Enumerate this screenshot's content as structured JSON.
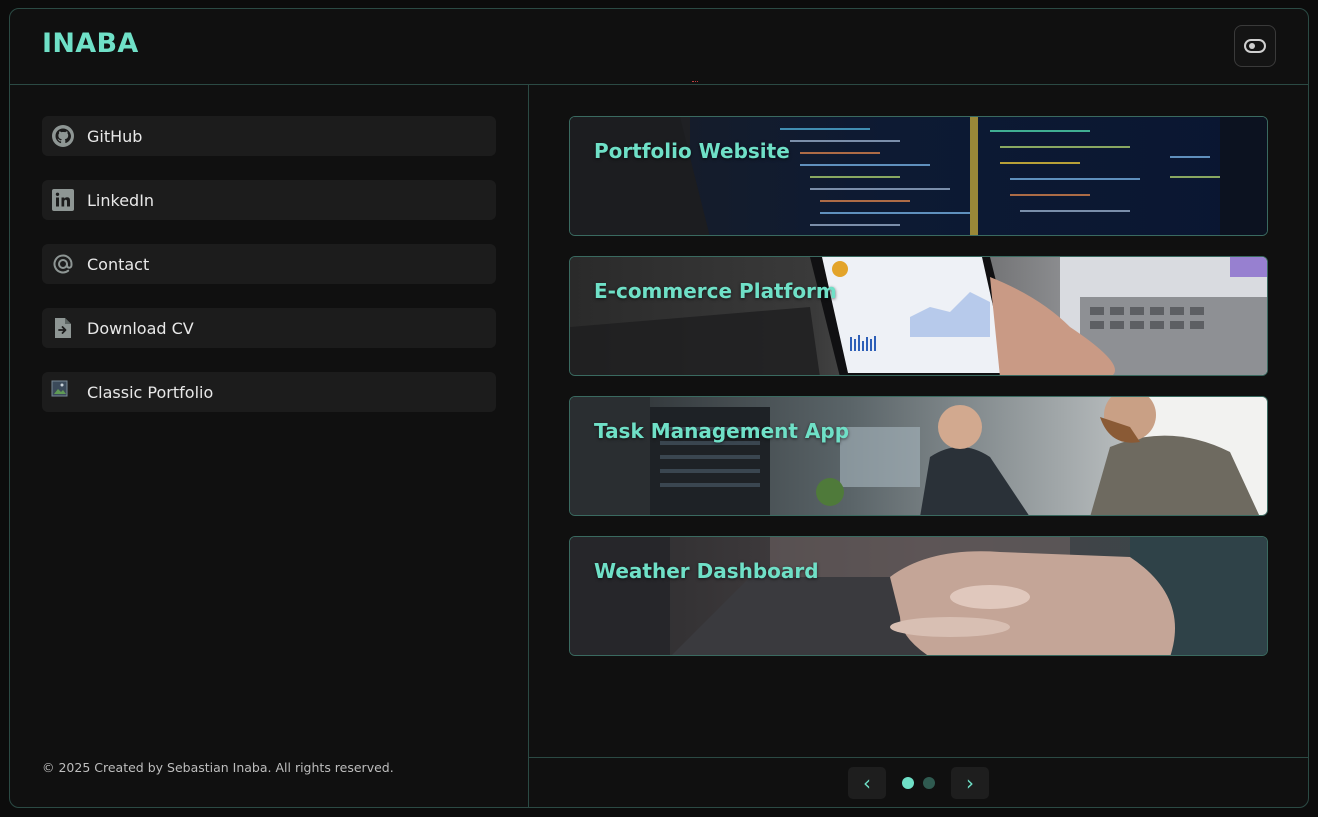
{
  "header": {
    "brand": "INABA",
    "theme_toggle_icon": "toggle-icon"
  },
  "sidebar": {
    "items": [
      {
        "label": "GitHub",
        "icon": "github-icon"
      },
      {
        "label": "LinkedIn",
        "icon": "linkedin-icon"
      },
      {
        "label": "Contact",
        "icon": "at-sign-icon"
      },
      {
        "label": "Download CV",
        "icon": "document-download-icon"
      },
      {
        "label": "Classic Portfolio",
        "icon": "broken-image-icon"
      }
    ],
    "footer": "© 2025 Created by Sebastian Inaba. All rights reserved."
  },
  "projects": {
    "cards": [
      {
        "title": "Portfolio Website"
      },
      {
        "title": "E-commerce Platform"
      },
      {
        "title": "Task Management App"
      },
      {
        "title": "Weather Dashboard"
      }
    ],
    "pagination": {
      "prev_label": "‹",
      "next_label": "›",
      "pages": 2,
      "current": 1
    }
  },
  "colors": {
    "accent": "#6fe0c7",
    "border": "#2b4a44",
    "background": "#101010",
    "item_bg": "#1c1c1c"
  }
}
